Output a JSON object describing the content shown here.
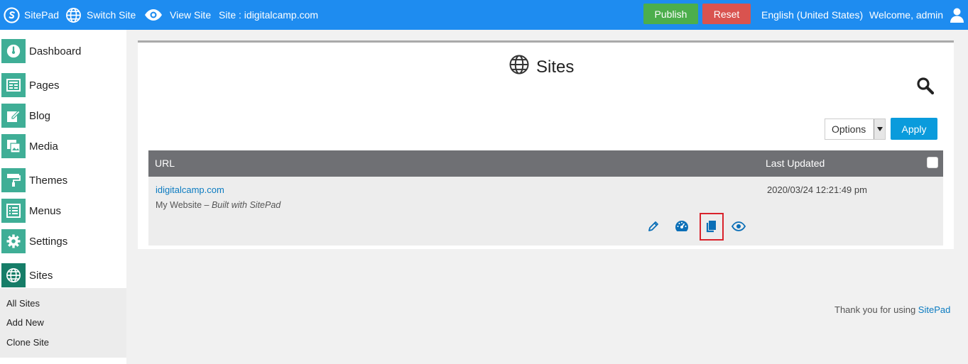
{
  "topbar": {
    "brand": "SitePad",
    "switch_site": "Switch Site",
    "view_site": "View Site",
    "site_label": "Site : idigitalcamp.com",
    "publish": "Publish",
    "reset": "Reset",
    "language": "English (United States)",
    "welcome": "Welcome, admin"
  },
  "sidebar": {
    "items": [
      {
        "label": "Dashboard",
        "icon": "dashboard-icon"
      },
      {
        "label": "Pages",
        "icon": "pages-icon"
      },
      {
        "label": "Blog",
        "icon": "blog-icon"
      },
      {
        "label": "Media",
        "icon": "media-icon"
      },
      {
        "label": "Themes",
        "icon": "themes-icon"
      },
      {
        "label": "Menus",
        "icon": "menus-icon"
      },
      {
        "label": "Settings",
        "icon": "settings-icon"
      },
      {
        "label": "Sites",
        "icon": "globe-icon"
      }
    ],
    "submenu": [
      "All Sites",
      "Add New",
      "Clone Site"
    ]
  },
  "main": {
    "title": "Sites",
    "options_value": "Options",
    "apply": "Apply",
    "table": {
      "headers": {
        "url": "URL",
        "updated": "Last Updated"
      },
      "rows": [
        {
          "url": "idigitalcamp.com",
          "desc_plain": "My Website – ",
          "desc_em": "Built with SitePad",
          "updated": "2020/03/24 12:21:49 pm"
        }
      ]
    }
  },
  "footer": {
    "text": "Thank you for using ",
    "link": "SitePad"
  },
  "colors": {
    "topbar": "#1e8cf0",
    "publish": "#4cae4c",
    "reset": "#d9534f",
    "nav_icon": "#3fae96",
    "nav_icon_active": "#167d68",
    "apply": "#0a9bdc",
    "table_head": "#6f7074",
    "link": "#0b7bc1",
    "highlight": "#d9232c"
  }
}
